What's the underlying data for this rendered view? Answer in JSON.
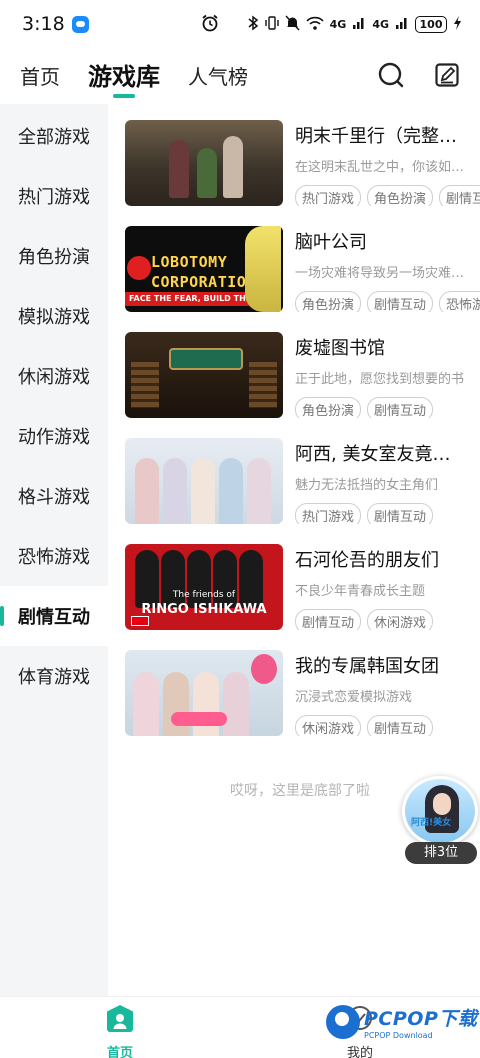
{
  "status_bar": {
    "time": "3:18",
    "network_type": "4G",
    "battery": "100"
  },
  "top_nav": {
    "tabs": [
      {
        "label": "首页",
        "active": false
      },
      {
        "label": "游戏库",
        "active": true
      },
      {
        "label": "人气榜",
        "active": false
      }
    ],
    "icons": [
      "search-icon",
      "edit-icon"
    ]
  },
  "sidebar": {
    "items": [
      {
        "label": "全部游戏",
        "active": false
      },
      {
        "label": "热门游戏",
        "active": false
      },
      {
        "label": "角色扮演",
        "active": false
      },
      {
        "label": "模拟游戏",
        "active": false
      },
      {
        "label": "休闲游戏",
        "active": false
      },
      {
        "label": "动作游戏",
        "active": false
      },
      {
        "label": "格斗游戏",
        "active": false
      },
      {
        "label": "恐怖游戏",
        "active": false
      },
      {
        "label": "剧情互动",
        "active": true
      },
      {
        "label": "体育游戏",
        "active": false
      }
    ]
  },
  "games": [
    {
      "title": "明末千里行（完整版）",
      "desc": "在这明末乱世之中，你该如何生存",
      "tags": [
        "热门游戏",
        "角色扮演",
        "剧情互动"
      ]
    },
    {
      "title": "脑叶公司",
      "desc": "一场灾难将导致另一场灾难的发生",
      "tags": [
        "角色扮演",
        "剧情互动",
        "恐怖游戏"
      ],
      "cover_text": {
        "logo_line1": "LOBOTOMY",
        "logo_line2": "CORPORATION",
        "banner": "FACE THE FEAR, BUILD THE FUTURE"
      }
    },
    {
      "title": "废墟图书馆",
      "desc": "正于此地，愿您找到想要的书",
      "tags": [
        "角色扮演",
        "剧情互动"
      ]
    },
    {
      "title": "阿西, 美女室友竟是我的…",
      "desc": "魅力无法抵挡的女主角们",
      "tags": [
        "热门游戏",
        "剧情互动"
      ]
    },
    {
      "title": "石河伦吾的朋友们",
      "desc": "不良少年青春成长主题",
      "tags": [
        "剧情互动",
        "休闲游戏"
      ],
      "cover_text": {
        "line1": "The friends of",
        "line2": "RINGO ISHIKAWA"
      }
    },
    {
      "title": "我的专属韩国女团",
      "desc": "沉浸式恋爱模拟游戏",
      "tags": [
        "休闲游戏",
        "剧情互动"
      ]
    }
  ],
  "list_end_text": "哎呀，这里是底部了啦",
  "rank_badge": {
    "label": "排3位",
    "caption": "阿西!美女"
  },
  "bottom_tabs": [
    {
      "label": "首页",
      "active": true
    },
    {
      "label": "我的",
      "active": false
    }
  ],
  "watermark": {
    "main": "PCPOP下载",
    "sub": "PCPOP Download"
  },
  "colors": {
    "accent": "#19b89c",
    "sidebar_bg": "#f4f5f7",
    "tag_border": "#cfcfcf",
    "muted_text": "#9a9a9a"
  }
}
